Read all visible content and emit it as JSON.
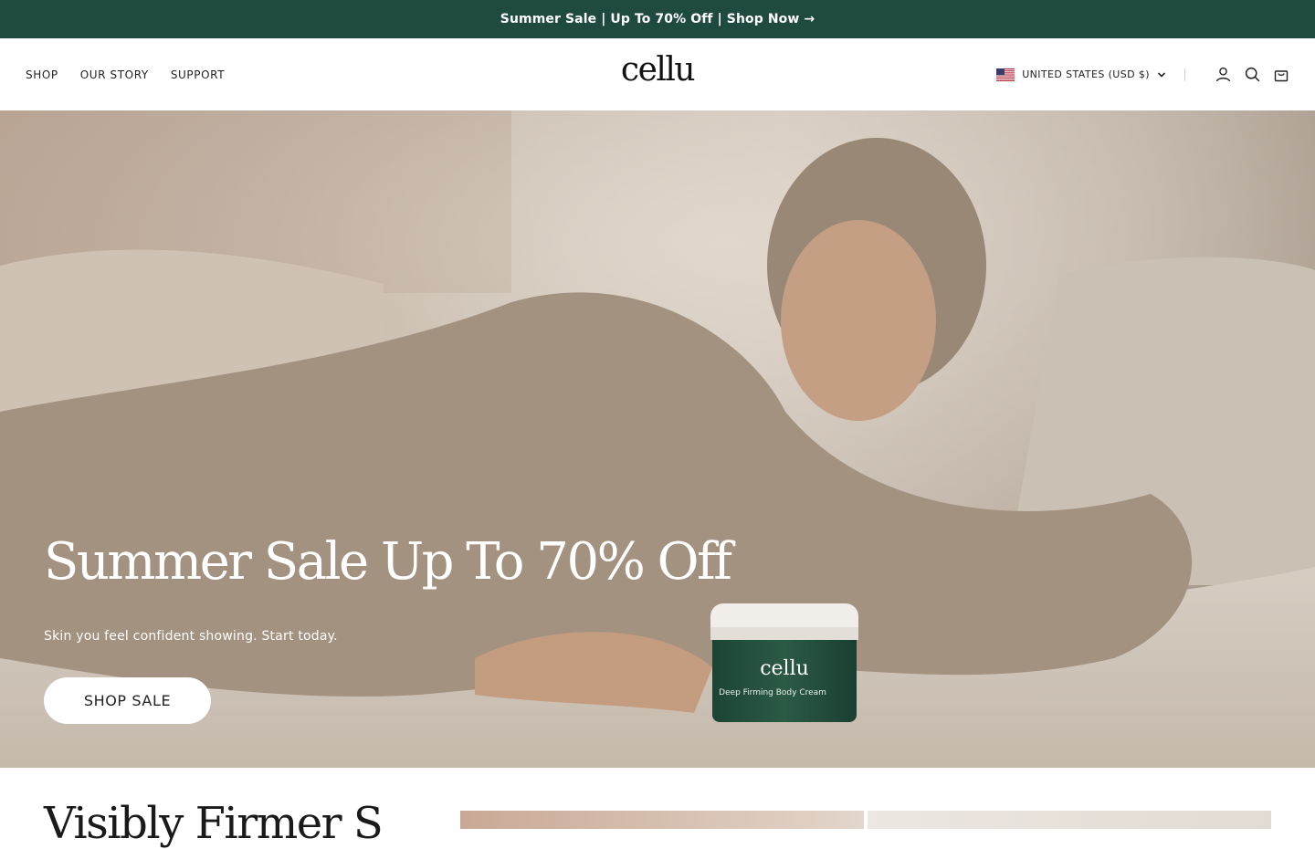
{
  "announcement": {
    "text": "Summer Sale | Up To 70% Off | Shop Now →"
  },
  "nav": {
    "links": [
      "SHOP",
      "OUR STORY",
      "SUPPORT"
    ],
    "logo": "cellu",
    "country_selector": "UNITED STATES (USD $)"
  },
  "icons": {
    "flag": "us-flag-icon",
    "dropdown": "chevron-down-icon",
    "account": "user-icon",
    "search": "search-icon",
    "cart": "cart-icon"
  },
  "hero": {
    "title": "Summer Sale Up To 70% Off",
    "subtitle": "Skin you feel confident showing. Start today.",
    "cta": "SHOP SALE",
    "product_label": "cellu",
    "product_name": "Deep Firming Body Cream"
  },
  "next_section": {
    "title": "Visibly Firmer S"
  },
  "colors": {
    "announcement_bg": "#1f4a40",
    "product_jar": "#23513f",
    "hero_text": "#ffffff"
  }
}
